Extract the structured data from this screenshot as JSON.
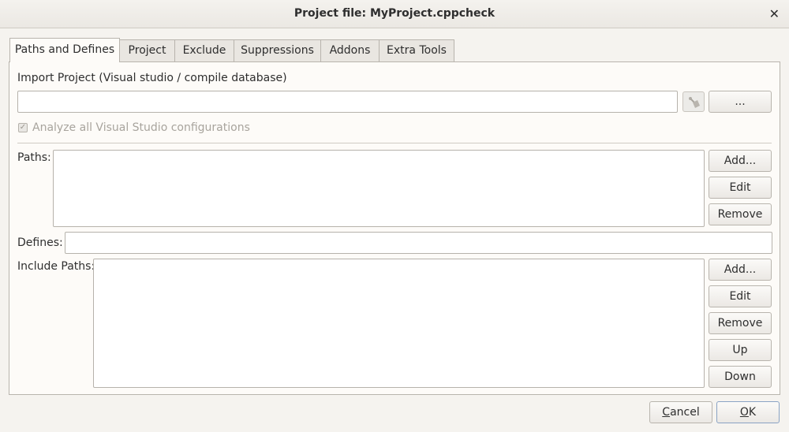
{
  "window": {
    "title": "Project file: MyProject.cppcheck",
    "close_glyph": "✕"
  },
  "tabs": [
    {
      "label": "Paths and Defines",
      "active": true
    },
    {
      "label": "Project",
      "active": false
    },
    {
      "label": "Exclude",
      "active": false
    },
    {
      "label": "Suppressions",
      "active": false
    },
    {
      "label": "Addons",
      "active": false
    },
    {
      "label": "Extra Tools",
      "active": false
    }
  ],
  "import": {
    "label": "Import Project (Visual studio / compile database)",
    "value": "",
    "browse_label": "...",
    "clear_icon": "clear-broom-icon",
    "analyze_all_label": "Analyze all Visual Studio configurations",
    "analyze_all_checked": true,
    "analyze_all_enabled": false
  },
  "paths": {
    "label": "Paths:",
    "items": [],
    "add_label": "Add...",
    "edit_label": "Edit",
    "remove_label": "Remove"
  },
  "defines": {
    "label": "Defines:",
    "value": ""
  },
  "include_paths": {
    "label": "Include Paths:",
    "items": [],
    "add_label": "Add...",
    "edit_label": "Edit",
    "remove_label": "Remove",
    "up_label": "Up",
    "down_label": "Down"
  },
  "footer": {
    "cancel_label": "Cancel",
    "cancel_mnemonic": "C",
    "cancel_rest": "ancel",
    "ok_label": "OK",
    "ok_mnemonic": "O",
    "ok_rest": "K"
  }
}
